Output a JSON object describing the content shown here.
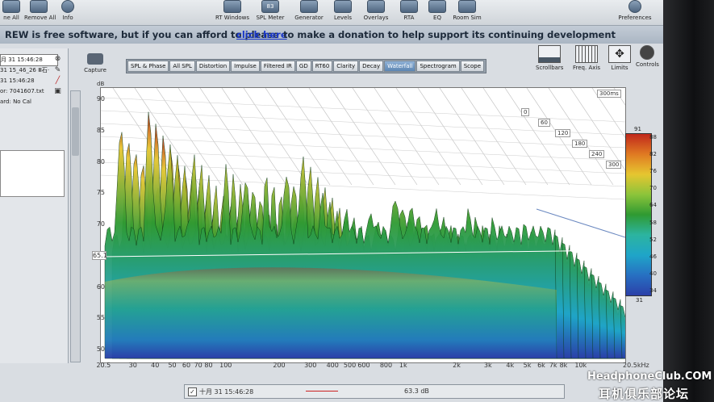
{
  "toolbar": {
    "left_buttons": [
      {
        "label": "ne All",
        "icon": "list-icon"
      },
      {
        "label": "Remove All",
        "icon": "remove-all-icon"
      },
      {
        "label": "Info",
        "icon": "info-icon"
      }
    ],
    "buttons": [
      {
        "label": "RT Windows",
        "icon": "windows-icon"
      },
      {
        "label": "SPL Meter",
        "icon": "spl-meter-icon",
        "badge": "83"
      },
      {
        "label": "Generator",
        "icon": "generator-icon"
      },
      {
        "label": "Levels",
        "icon": "levels-icon"
      },
      {
        "label": "Overlays",
        "icon": "overlays-icon"
      },
      {
        "label": "RTA",
        "icon": "rta-icon"
      },
      {
        "label": "EQ",
        "icon": "eq-icon"
      },
      {
        "label": "Room Sim",
        "icon": "room-sim-icon"
      }
    ],
    "preferences_label": "Preferences"
  },
  "donation": {
    "prefix": "REW is free software, but if you can afford to please",
    "link": "click here",
    "suffix": "to make a donation to help support its continuing development"
  },
  "measurements": {
    "selected_datetime": "月 31 15:46:28",
    "second_line": "31 15_46_26 Ⅲ石·",
    "third_line": "31 15:46:28",
    "mic": "or: 7041607.txt",
    "cal": "ard: No Cal"
  },
  "capture_label": "Capture",
  "tabs": [
    "SPL & Phase",
    "All SPL",
    "Distortion",
    "Impulse",
    "Filtered IR",
    "GD",
    "RT60",
    "Clarity",
    "Decay",
    "Waterfall",
    "Spectrogram",
    "Scope"
  ],
  "active_tab": "Waterfall",
  "controls": [
    {
      "label": "Scrollbars",
      "icon": "scrollbars-icon"
    },
    {
      "label": "Freq. Axis",
      "icon": "freq-axis-icon"
    },
    {
      "label": "Limits",
      "icon": "limits-icon"
    },
    {
      "label": "Controls",
      "icon": "controls-icon"
    }
  ],
  "chart_data": {
    "type": "waterfall",
    "ylabel": "dB",
    "y_ticks": [
      "90",
      "85",
      "80",
      "75",
      "70",
      "65.1",
      "60",
      "55",
      "50"
    ],
    "ylim": [
      50,
      90
    ],
    "cursor_level": "65.1",
    "x_ticks": [
      "20.5",
      "30",
      "40",
      "50",
      "60",
      "70",
      "80",
      "100",
      "200",
      "300",
      "400",
      "500",
      "600",
      "800",
      "1k",
      "2k",
      "3k",
      "4k",
      "5k",
      "6k",
      "7k",
      "8k",
      "10k",
      "20.5kHz"
    ],
    "x_unit": "Hz",
    "time_labels": [
      "0",
      "60",
      "120",
      "180",
      "240",
      "300",
      "300ms"
    ],
    "color_scale": [
      91,
      88,
      82,
      76,
      70,
      64,
      58,
      52,
      46,
      40,
      34,
      31
    ],
    "colors": {
      "peak": "#c0281c",
      "high": "#e6c630",
      "mid": "#2f9a32",
      "low": "#1fa5c8",
      "floor": "#2b3fa8"
    },
    "legend": {
      "name": "十月 31 15:46:28",
      "value": "63.3 dB"
    }
  },
  "watermark": {
    "text": "HeadphoneClub.COM",
    "cn": "耳机俱乐部论坛"
  }
}
